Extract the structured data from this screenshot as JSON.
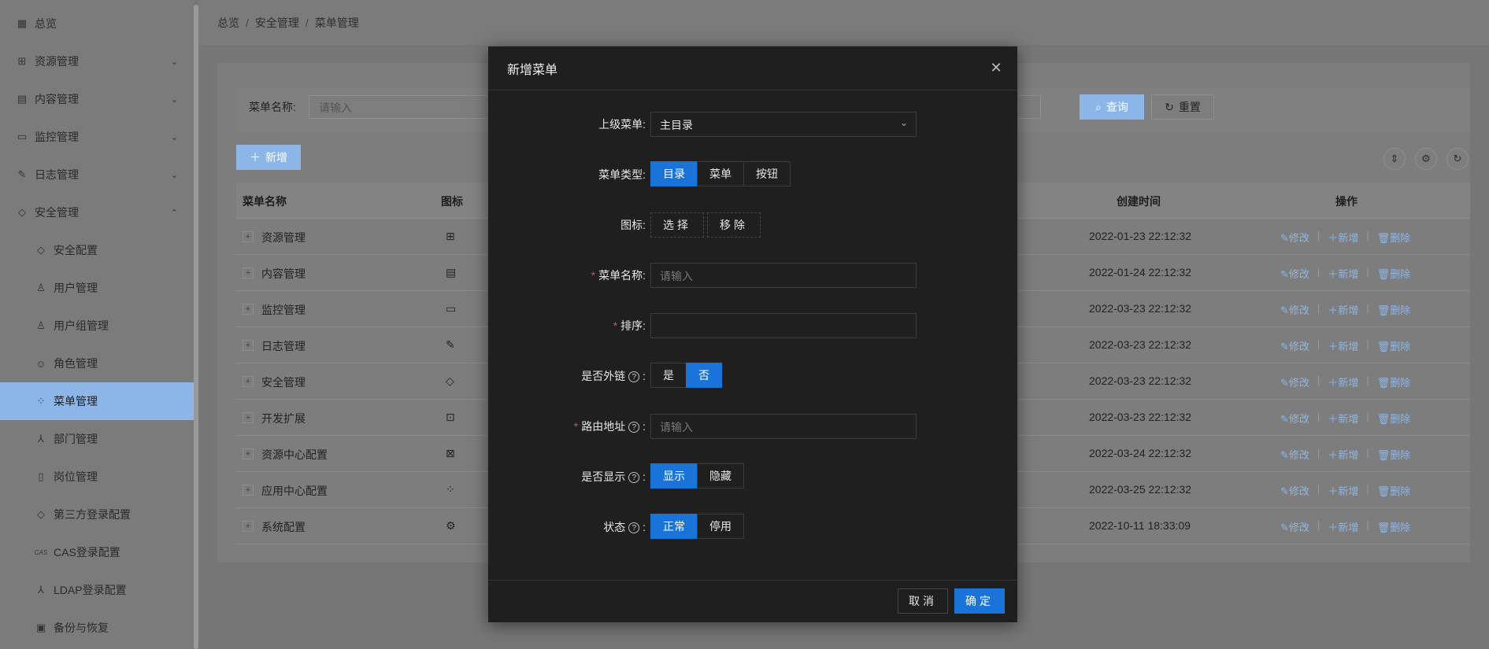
{
  "sidebar": {
    "items": [
      {
        "label": "总览",
        "icon": "dashboard-icon",
        "chevron": ""
      },
      {
        "label": "资源管理",
        "icon": "sitemap-icon",
        "chevron": "⌄"
      },
      {
        "label": "内容管理",
        "icon": "document-icon",
        "chevron": "⌄"
      },
      {
        "label": "监控管理",
        "icon": "monitor-icon",
        "chevron": "⌄"
      },
      {
        "label": "日志管理",
        "icon": "edit-icon",
        "chevron": "⌄"
      },
      {
        "label": "安全管理",
        "icon": "shield-icon",
        "chevron": "⌃"
      }
    ],
    "subitems": [
      {
        "label": "安全配置",
        "icon": "shield-icon"
      },
      {
        "label": "用户管理",
        "icon": "user-icon"
      },
      {
        "label": "用户组管理",
        "icon": "user-group-icon"
      },
      {
        "label": "角色管理",
        "icon": "role-icon"
      },
      {
        "label": "菜单管理",
        "icon": "menu-icon"
      },
      {
        "label": "部门管理",
        "icon": "department-icon"
      },
      {
        "label": "岗位管理",
        "icon": "post-icon"
      },
      {
        "label": "第三方登录配置",
        "icon": "shield-icon"
      },
      {
        "label": "CAS登录配置",
        "icon": "cas-icon"
      },
      {
        "label": "LDAP登录配置",
        "icon": "ldap-icon"
      },
      {
        "label": "备份与恢复",
        "icon": "backup-icon"
      }
    ]
  },
  "breadcrumb": [
    "总览",
    "安全管理",
    "菜单管理"
  ],
  "search": {
    "label": "菜单名称:",
    "placeholder": "请输入",
    "query_label": "查询",
    "reset_label": "重置"
  },
  "toolbar": {
    "add_label": "新增"
  },
  "table": {
    "headers": {
      "name": "菜单名称",
      "icon": "图标",
      "created": "创建时间",
      "actions": "操作"
    },
    "rows": [
      {
        "name": "资源管理",
        "icon": "sitemap-icon",
        "created": "2022-01-23 22:12:32"
      },
      {
        "name": "内容管理",
        "icon": "document-icon",
        "created": "2022-01-24 22:12:32"
      },
      {
        "name": "监控管理",
        "icon": "monitor-icon",
        "created": "2022-03-23 22:12:32"
      },
      {
        "name": "日志管理",
        "icon": "edit-icon",
        "created": "2022-03-23 22:12:32"
      },
      {
        "name": "安全管理",
        "icon": "shield-icon",
        "created": "2022-03-23 22:12:32"
      },
      {
        "name": "开发扩展",
        "icon": "toolbox-icon",
        "created": "2022-03-23 22:12:32"
      },
      {
        "name": "资源中心配置",
        "icon": "resource-icon",
        "created": "2022-03-24 22:12:32"
      },
      {
        "name": "应用中心配置",
        "icon": "apps-icon",
        "created": "2022-03-25 22:12:32"
      },
      {
        "name": "系统配置",
        "icon": "gear-icon",
        "created": "2022-10-11 18:33:09"
      }
    ],
    "actions": {
      "edit": "修改",
      "add": "新增",
      "delete": "删除"
    }
  },
  "modal": {
    "title": "新增菜单",
    "parent": {
      "label": "上级菜单:",
      "value": "主目录"
    },
    "type": {
      "label": "菜单类型:",
      "options": [
        "目录",
        "菜单",
        "按钮"
      ],
      "selected": "目录"
    },
    "icon": {
      "label": "图标:",
      "select": "选择",
      "remove": "移除"
    },
    "name": {
      "label": "菜单名称:",
      "placeholder": "请输入"
    },
    "order": {
      "label": "排序:",
      "placeholder": ""
    },
    "external": {
      "label": "是否外链",
      "options": [
        "是",
        "否"
      ],
      "selected": "否"
    },
    "route": {
      "label": "路由地址",
      "placeholder": "请输入"
    },
    "visible": {
      "label": "是否显示",
      "options": [
        "显示",
        "隐藏"
      ],
      "selected": "显示"
    },
    "status": {
      "label": "状态",
      "options": [
        "正常",
        "停用"
      ],
      "selected": "正常"
    },
    "cancel_label": "取消",
    "ok_label": "确定"
  },
  "colors": {
    "primary": "#1a73d9",
    "primary_dim": "#8db6e8",
    "modal_bg": "#1f1f1f",
    "required": "#e84a4a"
  }
}
